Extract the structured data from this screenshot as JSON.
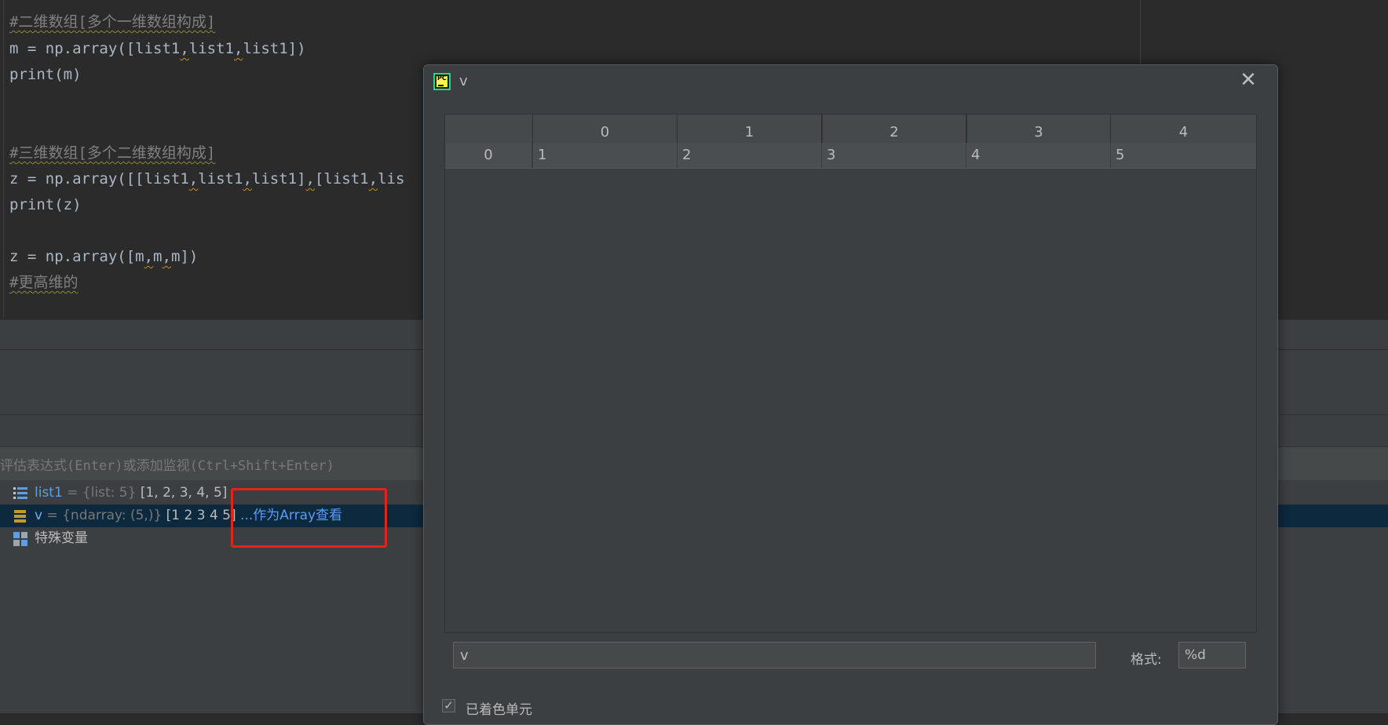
{
  "editor": {
    "lines": [
      {
        "parts": [
          {
            "t": "#二维数组[多个一维数组构成]",
            "c": "comment"
          }
        ]
      },
      {
        "parts": [
          {
            "t": "m = np.array([list1",
            "c": ""
          },
          {
            "t": ",",
            "c": "warn"
          },
          {
            "t": "list1",
            "c": ""
          },
          {
            "t": ",",
            "c": "warn"
          },
          {
            "t": "list1])",
            "c": ""
          }
        ]
      },
      {
        "parts": [
          {
            "t": "print(m)",
            "c": ""
          }
        ]
      },
      {
        "parts": [
          {
            "t": "#三维数组[多个二维数组构成]",
            "c": "comment"
          }
        ]
      },
      {
        "parts": [
          {
            "t": "z = np.array([[list1",
            "c": ""
          },
          {
            "t": ",",
            "c": "warn"
          },
          {
            "t": "list1",
            "c": ""
          },
          {
            "t": ",",
            "c": "warn"
          },
          {
            "t": "list1]",
            "c": ""
          },
          {
            "t": ",",
            "c": "warn"
          },
          {
            "t": "[list1",
            "c": ""
          },
          {
            "t": ",",
            "c": "warn"
          },
          {
            "t": "lis",
            "c": ""
          }
        ]
      },
      {
        "parts": [
          {
            "t": "print(z)",
            "c": ""
          }
        ]
      },
      {
        "parts": [
          {
            "t": "z = np.array([m",
            "c": ""
          },
          {
            "t": ",",
            "c": "warn"
          },
          {
            "t": "m",
            "c": ""
          },
          {
            "t": ",",
            "c": "warn"
          },
          {
            "t": "m])",
            "c": ""
          }
        ]
      },
      {
        "parts": [
          {
            "t": "#更高维的",
            "c": "comment"
          }
        ]
      }
    ]
  },
  "debugger": {
    "eval_hint": "评估表达式(Enter)或添加监视(Ctrl+Shift+Enter)",
    "variables": [
      {
        "name": "list1",
        "type": " = {list: 5} ",
        "value": "[1, 2, 3, 4, 5]",
        "link": "",
        "icon": "list-icon"
      },
      {
        "name": "v",
        "type": " = {ndarray: (5,)} ",
        "value": "[1 2 3 4 5]",
        "link": " ...作为Array查看",
        "icon": "ndarray-icon"
      },
      {
        "name": "特殊变量",
        "type": "",
        "value": "",
        "link": "",
        "icon": "special-vars-icon"
      }
    ]
  },
  "dialog": {
    "title": "v",
    "close_symbol": "✕",
    "column_headers": [
      "0",
      "1",
      "2",
      "3",
      "4"
    ],
    "rows": [
      {
        "header": "0",
        "cells": [
          "1",
          "2",
          "3",
          "4",
          "5"
        ]
      }
    ],
    "expression": "v",
    "format_label": "格式:",
    "format_value": "%d",
    "colored_cells_label": "已着色单元",
    "colored_cells_checked": true
  },
  "colors": {
    "editor_bg": "#2b2b2b",
    "panel_bg": "#3c3f41",
    "selection_bg": "#0d293e",
    "highlight_box": "#e2231a",
    "link": "#589df6"
  }
}
